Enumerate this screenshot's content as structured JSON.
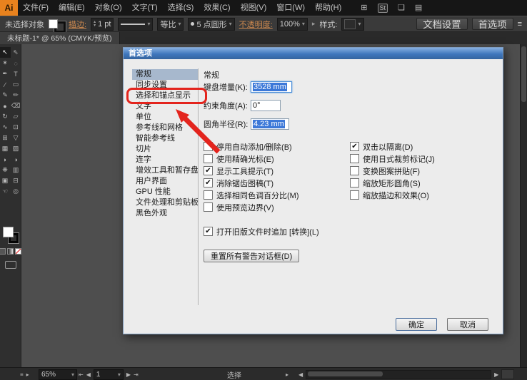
{
  "glyphs": {
    "dropdown": "▾",
    "up": "▴",
    "down": "▾",
    "chevron_right": "▸",
    "nav_first": "⇤",
    "nav_prev": "◀",
    "nav_next": "▶",
    "nav_last": "⇥",
    "check": "✔",
    "menu": "≡"
  },
  "menubar": {
    "logo": "Ai",
    "items": [
      {
        "label": "文件(F)"
      },
      {
        "label": "编辑(E)"
      },
      {
        "label": "对象(O)"
      },
      {
        "label": "文字(T)"
      },
      {
        "label": "选择(S)"
      },
      {
        "label": "效果(C)"
      },
      {
        "label": "视图(V)"
      },
      {
        "label": "窗口(W)"
      },
      {
        "label": "帮助(H)"
      }
    ],
    "right_icons": [
      {
        "name": "arrange-documents-icon",
        "glyph": "⊞"
      },
      {
        "name": "adobe-stock-icon",
        "glyph": "St",
        "box": true
      },
      {
        "name": "panels-icon",
        "glyph": "❏"
      },
      {
        "name": "workspace-switcher-icon",
        "glyph": "▤"
      }
    ]
  },
  "control_bar": {
    "no_selection_label": "未选择对象",
    "stroke_label": "描边:",
    "stroke_value": "1 pt",
    "variable_width_label": "等比",
    "brush_label": "5 点圆形",
    "opacity_label": "不透明度:",
    "opacity_value": "100%",
    "style_label": "样式:",
    "document_setup_label": "文档设置",
    "preferences_label": "首选项"
  },
  "document_tab": {
    "title": "未标题-1* @ 65% (CMYK/预览)"
  },
  "tools": [
    {
      "name": "selection-tool",
      "glyph": "↖"
    },
    {
      "name": "direct-selection-tool",
      "glyph": "⇖"
    },
    {
      "name": "magic-wand-tool",
      "glyph": "✶"
    },
    {
      "name": "lasso-tool",
      "glyph": "◌"
    },
    {
      "name": "pen-tool",
      "glyph": "✒"
    },
    {
      "name": "type-tool",
      "glyph": "T"
    },
    {
      "name": "line-segment-tool",
      "glyph": "∕"
    },
    {
      "name": "rectangle-tool",
      "glyph": "▭"
    },
    {
      "name": "paintbrush-tool",
      "glyph": "✎"
    },
    {
      "name": "pencil-tool",
      "glyph": "✏"
    },
    {
      "name": "blob-brush-tool",
      "glyph": "●"
    },
    {
      "name": "eraser-tool",
      "glyph": "⌫"
    },
    {
      "name": "rotate-tool",
      "glyph": "↻"
    },
    {
      "name": "scale-tool",
      "glyph": "▱"
    },
    {
      "name": "width-tool",
      "glyph": "∿"
    },
    {
      "name": "free-transform-tool",
      "glyph": "⊡"
    },
    {
      "name": "shape-builder-tool",
      "glyph": "⊞"
    },
    {
      "name": "perspective-grid-tool",
      "glyph": "▽"
    },
    {
      "name": "mesh-tool",
      "glyph": "▦"
    },
    {
      "name": "gradient-tool",
      "glyph": "▨"
    },
    {
      "name": "eyedropper-tool",
      "glyph": "◗"
    },
    {
      "name": "blend-tool",
      "glyph": "◑"
    },
    {
      "name": "symbol-sprayer-tool",
      "glyph": "❋"
    },
    {
      "name": "column-graph-tool",
      "glyph": "▥"
    },
    {
      "name": "artboard-tool",
      "glyph": "▣"
    },
    {
      "name": "slice-tool",
      "glyph": "⊟"
    },
    {
      "name": "hand-tool",
      "glyph": "☜"
    },
    {
      "name": "zoom-tool",
      "glyph": "◎"
    }
  ],
  "dialog": {
    "title": "首选项",
    "sidebar": [
      {
        "label": "常规",
        "selected": true
      },
      {
        "label": "同步设置"
      },
      {
        "label": "选择和锚点显示",
        "annotated": true
      },
      {
        "label": "文字"
      },
      {
        "label": "单位"
      },
      {
        "label": "参考线和网格"
      },
      {
        "label": "智能参考线"
      },
      {
        "label": "切片"
      },
      {
        "label": "连字"
      },
      {
        "label": "增效工具和暂存盘"
      },
      {
        "label": "用户界面"
      },
      {
        "label": "GPU 性能"
      },
      {
        "label": "文件处理和剪贴板"
      },
      {
        "label": "黑色外观"
      }
    ],
    "section_title": "常规",
    "fields": [
      {
        "label": "键盘增量(K):",
        "value": "3528 mm",
        "selected": true
      },
      {
        "label": "约束角度(A):",
        "value": "0°",
        "selected": false
      },
      {
        "label": "圆角半径(R):",
        "value": "4.23 mm",
        "selected": true
      }
    ],
    "checkboxes_left": [
      {
        "label": "停用自动添加/删除(B)",
        "checked": false
      },
      {
        "label": "使用精确光标(E)",
        "checked": false
      },
      {
        "label": "显示工具提示(T)",
        "checked": true
      },
      {
        "label": "消除锯齿图稿(T)",
        "checked": true
      },
      {
        "label": "选择相同色调百分比(M)",
        "checked": false
      },
      {
        "label": "使用预览边界(V)",
        "checked": false
      },
      {
        "label": "打开旧版文件时追加 [转换](L)",
        "checked": true,
        "gap": true
      }
    ],
    "checkboxes_right": [
      {
        "label": "双击以隔离(D)",
        "checked": true
      },
      {
        "label": "使用日式裁剪标记(J)",
        "checked": false
      },
      {
        "label": "变换图案拼贴(F)",
        "checked": false
      },
      {
        "label": "缩放矩形圆角(S)",
        "checked": false
      },
      {
        "label": "缩放描边和效果(O)",
        "checked": false
      }
    ],
    "reset_warnings_label": "重置所有警告对话框(D)",
    "ok_label": "确定",
    "cancel_label": "取消"
  },
  "statusbar": {
    "zoom_value": "65%",
    "page_value": "1",
    "status_label": "选择"
  },
  "colors": {
    "annotation_red": "#e3241d",
    "titlebar_blue": "#3f77bd",
    "selection_blue": "#3c78d8",
    "logo_orange": "#e8821e"
  }
}
